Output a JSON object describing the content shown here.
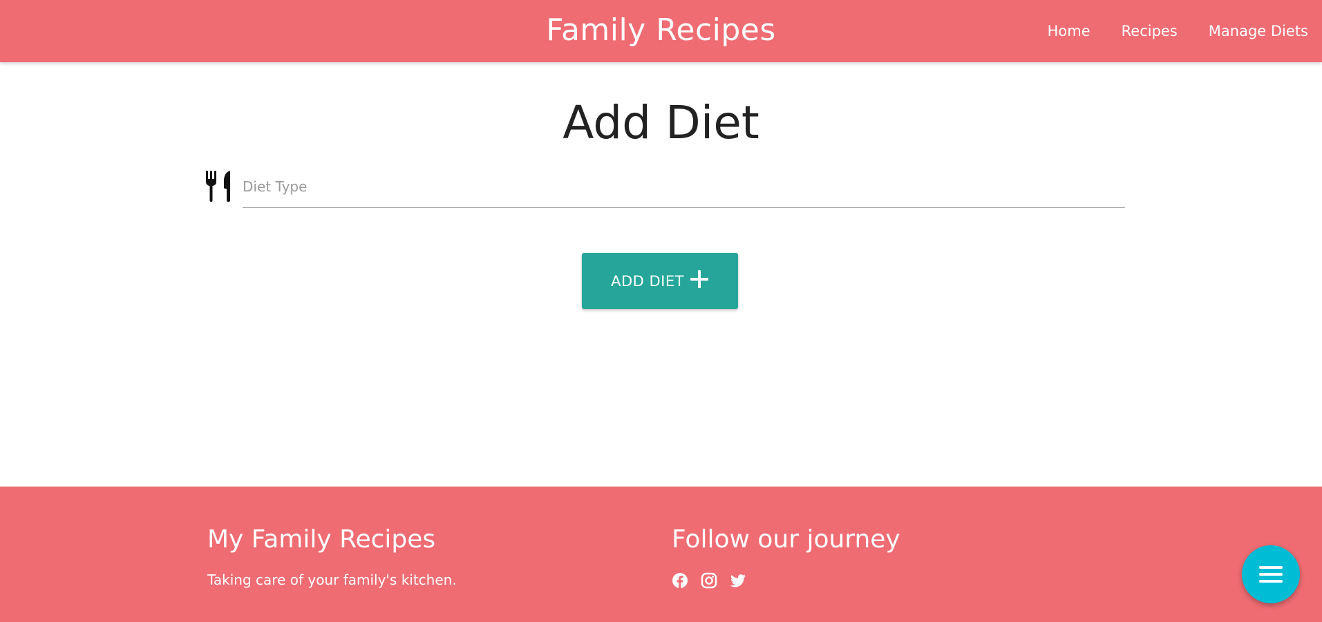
{
  "navbar": {
    "brand": "Family Recipes",
    "links": [
      "Home",
      "Recipes",
      "Manage Diets"
    ],
    "color": "#ef6c73"
  },
  "main": {
    "title": "Add Diet",
    "field": {
      "icon": "utensils-icon",
      "placeholder": "Diet Type",
      "value": ""
    },
    "button": {
      "label": "ADD DIET",
      "icon": "plus-icon",
      "color": "#26a69a"
    }
  },
  "footer": {
    "left_title": "My Family Recipes",
    "left_text": "Taking care of your family's kitchen.",
    "right_title": "Follow our journey",
    "social_icons": [
      "facebook-icon",
      "instagram-icon",
      "twitter-icon"
    ],
    "color": "#ef6c73"
  },
  "fab": {
    "icon": "menu-icon",
    "color": "#00bcd4"
  }
}
